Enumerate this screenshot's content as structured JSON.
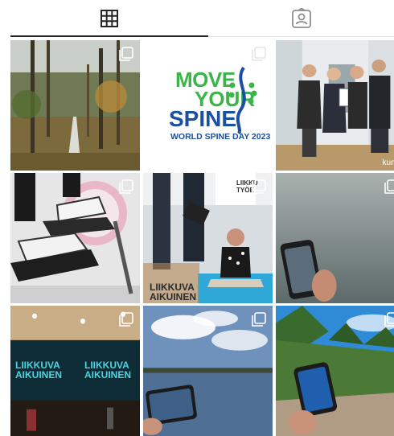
{
  "tabs": [
    {
      "name": "posts-grid",
      "icon": "grid-icon",
      "active": true
    },
    {
      "name": "tagged",
      "icon": "tagged-person-icon",
      "active": false
    }
  ],
  "posts": [
    {
      "id": 1,
      "type": "carousel",
      "description_icon": "multiple-posts-icon"
    },
    {
      "id": 2,
      "type": "carousel",
      "text": {
        "line1": "MOVE",
        "line2": "YOUR",
        "line3": "SPINE",
        "line4": "WORLD SPINE DAY 2023"
      }
    },
    {
      "id": 3,
      "type": "photo",
      "watermark": "kumu"
    },
    {
      "id": 4,
      "type": "carousel"
    },
    {
      "id": 5,
      "type": "carousel",
      "logo": {
        "line1": "LIIKKUVA",
        "line2": "AIKUINEN"
      },
      "corner_logo": {
        "line1": "LIIKKU",
        "line2": "TYÖE"
      }
    },
    {
      "id": 6,
      "type": "carousel"
    },
    {
      "id": 7,
      "type": "carousel",
      "screen_logos": [
        {
          "line1": "LIIKKUVA",
          "line2": "AIKUINEN"
        },
        {
          "line1": "LIIKKUVA",
          "line2": "AIKUINEN"
        }
      ]
    },
    {
      "id": 8,
      "type": "carousel"
    },
    {
      "id": 9,
      "type": "carousel"
    }
  ],
  "colors": {
    "accent_green": "#3bb54a",
    "accent_blue": "#1b4fa0",
    "logo_cyan": "#4fd3e0"
  }
}
